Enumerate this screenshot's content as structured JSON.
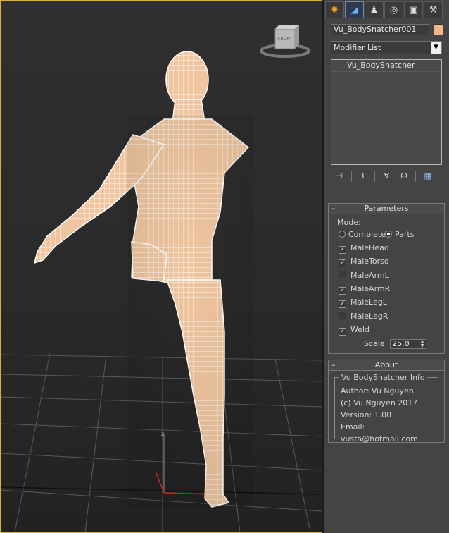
{
  "viewport": {
    "viewcube_label": "FRONT",
    "axis_label": "z"
  },
  "panel": {
    "tabs": [
      {
        "name": "create",
        "glyph": "✸"
      },
      {
        "name": "modify",
        "glyph": "◢"
      },
      {
        "name": "hierarchy",
        "glyph": "♟"
      },
      {
        "name": "motion",
        "glyph": "◎"
      },
      {
        "name": "display",
        "glyph": "▣"
      },
      {
        "name": "utilities",
        "glyph": "⚒"
      }
    ],
    "object_name": "Vu_BodySnatcher001",
    "object_color": "#f0b98d",
    "modifier_list": "Modifier List",
    "stack_items": [
      "Vu_BodySnatcher"
    ],
    "stack_tools": [
      {
        "name": "pin-stack-icon",
        "glyph": "⊣"
      },
      {
        "name": "show-end-result-icon",
        "glyph": "I"
      },
      {
        "name": "make-unique-icon",
        "glyph": "∀"
      },
      {
        "name": "remove-modifier-icon",
        "glyph": "☊"
      },
      {
        "name": "configure-modifier-sets-icon",
        "glyph": "▦"
      }
    ]
  },
  "parameters": {
    "title": "Parameters",
    "mode_label": "Mode:",
    "mode_options": [
      {
        "label": "Complete",
        "selected": false
      },
      {
        "label": "Parts",
        "selected": true
      }
    ],
    "checkboxes": [
      {
        "label": "MaleHead",
        "checked": true
      },
      {
        "label": "MaleTorso",
        "checked": true
      },
      {
        "label": "MaleArmL",
        "checked": false
      },
      {
        "label": "MaleArmR",
        "checked": true
      },
      {
        "label": "MaleLegL",
        "checked": true
      },
      {
        "label": "MaleLegR",
        "checked": false
      },
      {
        "label": "Weld",
        "checked": true
      }
    ],
    "scale_label": "Scale",
    "scale_value": "25.0"
  },
  "about": {
    "title": "About",
    "group_title": "Vu BodySnatcher Info",
    "author": "Author: Vu Nguyen",
    "copyright": "(c) Vu Nguyen 2017",
    "version": "Version: 1.00",
    "email": "Email: vusta@hotmail.com"
  },
  "colors": {
    "viewport_border": "#d9b040",
    "mesh_fill": "#f0c6a0",
    "wire": "#ffffff"
  }
}
